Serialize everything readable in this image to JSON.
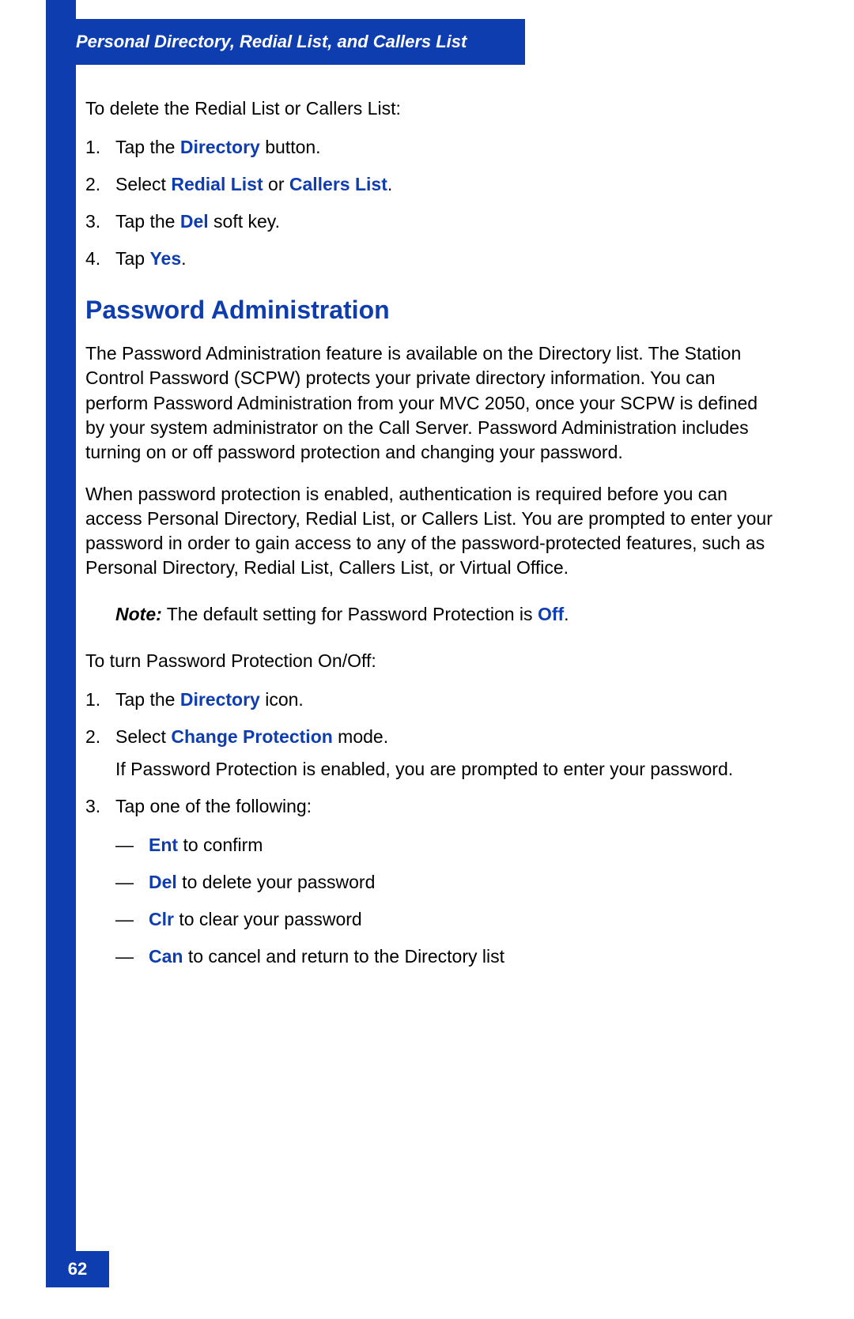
{
  "header": "Personal Directory, Redial List, and Callers List",
  "intro1": "To delete the Redial List or Callers List:",
  "list1": {
    "item1": {
      "num": "1.",
      "prefix": "Tap the ",
      "bold": "Directory",
      "suffix": " button."
    },
    "item2": {
      "num": "2.",
      "prefix": "Select ",
      "bold1": "Redial List",
      "mid": " or ",
      "bold2": "Callers List",
      "suffix": "."
    },
    "item3": {
      "num": "3.",
      "prefix": "Tap the ",
      "bold": "Del",
      "suffix": " soft key."
    },
    "item4": {
      "num": "4.",
      "prefix": "Tap ",
      "bold": "Yes",
      "suffix": "."
    }
  },
  "heading": "Password Administration",
  "para1": "The Password Administration feature is available on the Directory list. The Station Control Password (SCPW) protects your private directory information. You can perform Password Administration from your MVC 2050, once your SCPW is defined by your system administrator on the Call Server. Password Administration includes turning on or off password protection and changing your password.",
  "para2": "When password protection is enabled, authentication is required before you can access Personal Directory, Redial List, or Callers List. You are prompted to enter your password in order to gain access to any of the password-protected features, such as Personal Directory, Redial List, Callers List, or Virtual Office.",
  "note": {
    "label": "Note:",
    "text": " The default setting for Password Protection is ",
    "bold": "Off",
    "suffix": "."
  },
  "intro2": "To turn Password Protection On/Off:",
  "list2": {
    "item1": {
      "num": "1.",
      "prefix": "Tap the ",
      "bold": "Directory",
      "suffix": " icon."
    },
    "item2": {
      "num": "2.",
      "prefix": "Select ",
      "bold": "Change Protection",
      "suffix": " mode.",
      "cont": "If Password Protection is enabled, you are prompted to enter your password."
    },
    "item3": {
      "num": "3.",
      "text": "Tap one of the following:",
      "sub": {
        "dash": "—",
        "a": {
          "bold": "Ent",
          "text": " to confirm"
        },
        "b": {
          "bold": "Del",
          "text": " to delete your password"
        },
        "c": {
          "bold": "Clr",
          "text": " to clear your password"
        },
        "d": {
          "bold": "Can",
          "text": " to cancel and return to the Directory list"
        }
      }
    }
  },
  "pageNumber": "62"
}
